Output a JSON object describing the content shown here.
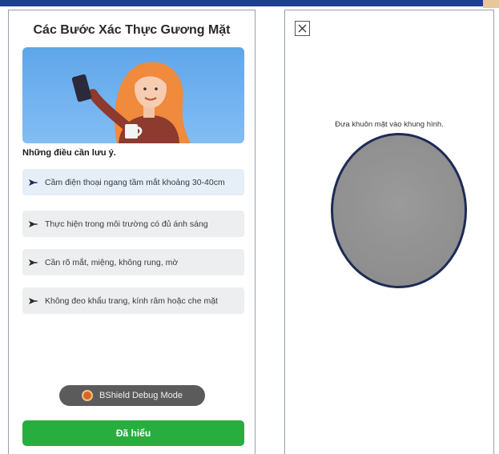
{
  "colors": {
    "accent": "#27ae3f",
    "oval_border": "#1d2b55",
    "hero_bg": "#6aaeef"
  },
  "left_panel": {
    "title": "Các Bước Xác Thực Gương Mặt",
    "notes_title": "Những điều cần lưu ý.",
    "tips": [
      {
        "icon": "arrow-icon",
        "text": "Cầm điện thoại ngang tầm mắt khoảng 30-40cm"
      },
      {
        "icon": "arrow-icon",
        "text": "Thực hiện trong môi trường có đủ ánh sáng"
      },
      {
        "icon": "arrow-icon",
        "text": "Cần rõ mắt, miệng, không rung, mờ"
      },
      {
        "icon": "arrow-icon",
        "text": "Không đeo khẩu trang, kính râm hoặc che mặt"
      }
    ],
    "debug_label": "BShield Debug Mode",
    "confirm_label": "Đã hiểu"
  },
  "right_panel": {
    "instruction": "Đưa khuôn mặt vào khung hình."
  }
}
